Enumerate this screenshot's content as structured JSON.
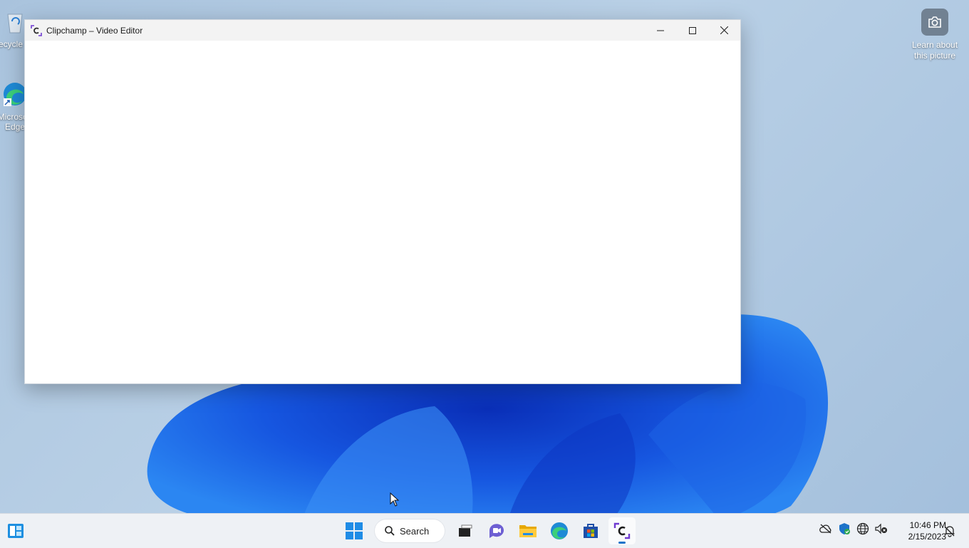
{
  "desktop": {
    "icons": [
      {
        "label": "Recycle Bin",
        "icon": "recycle-bin-icon"
      },
      {
        "label": "Microsoft Edge",
        "icon": "edge-icon"
      }
    ],
    "spotlight": {
      "line1": "Learn about",
      "line2": "this picture",
      "icon": "camera-icon"
    }
  },
  "window": {
    "title": "Clipchamp – Video Editor",
    "icon": "clipchamp-icon",
    "controls": [
      "minimize-icon",
      "maximize-icon",
      "close-icon"
    ]
  },
  "taskbar": {
    "search_label": "Search",
    "pinned": [
      "start-icon",
      "task-view-icon",
      "teams-chat-icon",
      "file-explorer-icon",
      "edge-icon",
      "microsoft-store-icon",
      "clipchamp-icon"
    ],
    "active_app": "clipchamp-icon",
    "tray": [
      "onedrive-offline-icon",
      "defender-icon",
      "network-icon",
      "volume-muted-icon"
    ],
    "time": "10:46 PM",
    "date": "2/15/2023"
  },
  "colors": {
    "accent": "#1a73c9",
    "clipchamp": "#6f3bd1"
  }
}
